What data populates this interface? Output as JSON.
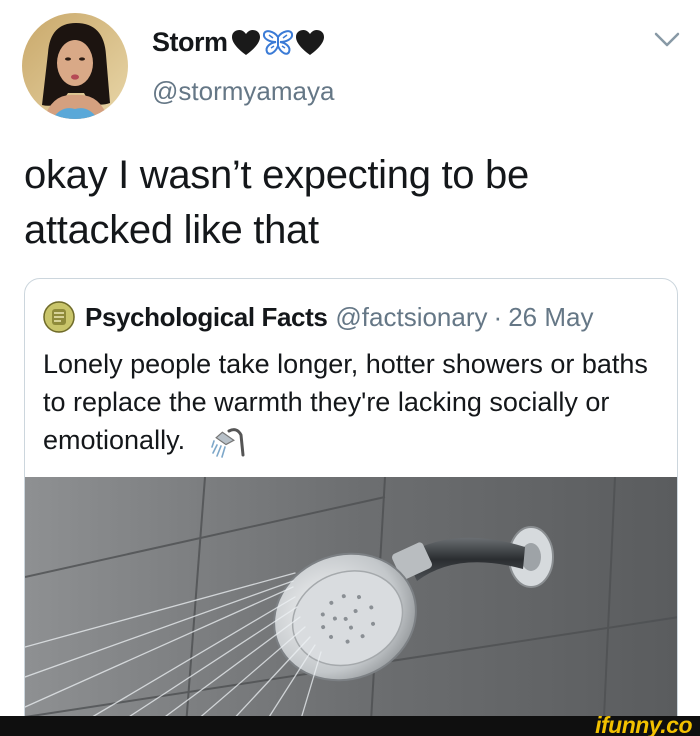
{
  "tweet": {
    "display_name": "Storm",
    "name_emojis": [
      "black-heart",
      "blue-butterfly",
      "black-heart"
    ],
    "handle": "@stormyamaya",
    "text": "okay I wasn’t expecting to be attacked like that"
  },
  "quoted_tweet": {
    "name": "Psychological Facts",
    "handle": "@factsionary",
    "separator": "·",
    "date": "26 May",
    "text": "Lonely people take longer, hotter showers or baths to replace the warmth they're lacking socially or emotionally.",
    "emoji": "shower",
    "image": "shower-head-photo"
  },
  "watermark": "ifunny.co",
  "colors": {
    "text": "#14171a",
    "secondary": "#657786",
    "border": "#ccd6dd",
    "watermark": "#f2c100",
    "butterfly": "#3b7bd6"
  }
}
